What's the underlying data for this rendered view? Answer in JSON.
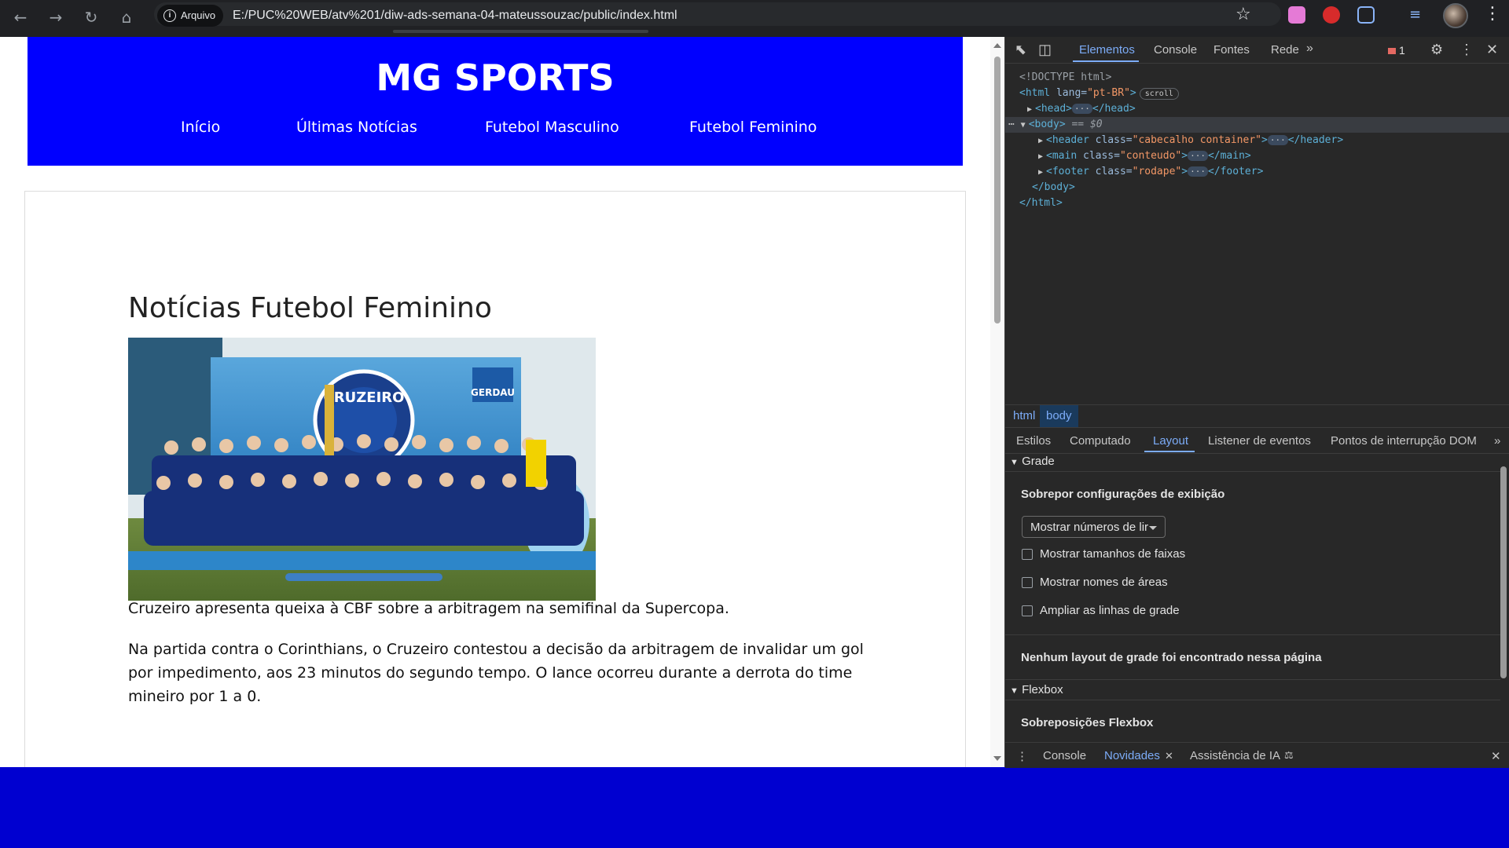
{
  "browser": {
    "security_chip": "Arquivo",
    "url": "E:/PUC%20WEB/atv%201/diw-ads-semana-04-mateussouzac/public/index.html"
  },
  "site": {
    "title": "MG SPORTS",
    "nav": [
      "Início",
      "Últimas Notícias",
      "Futebol Masculino",
      "Futebol Feminino"
    ],
    "section_title": "Notícias Futebol Feminino",
    "photo_text": {
      "club": "CRUZEIRO",
      "sponsor": "GERDAU"
    },
    "caption": "Cruzeiro apresenta queixa à CBF sobre a arbitragem na semifinal da Supercopa.",
    "paragraph": "Na partida contra o Corinthians, o Cruzeiro contestou a decisão da arbitragem de invalidar um gol por impedimento, aos 23 minutos do segundo tempo. O lance ocorreu durante a derrota do time mineiro por 1 a 0."
  },
  "devtools": {
    "tabs": [
      "Elementos",
      "Console",
      "Fontes",
      "Rede"
    ],
    "active_tab": "Elementos",
    "error_count": "1",
    "dom": {
      "doctype": "<!DOCTYPE html>",
      "html_open": "<html",
      "html_lang_attr": "lang",
      "html_lang_val": "\"pt-BR\"",
      "scroll_badge": "scroll",
      "head": "<head>",
      "head_close": "</head>",
      "body": "<body>",
      "body_marker": "== $0",
      "header_open": "<header",
      "header_class_val": "\"cabecalho container\"",
      "header_close": "</header>",
      "main_open": "<main",
      "main_class_val": "\"conteudo\"",
      "main_close": "</main>",
      "footer_open": "<footer",
      "footer_class_val": "\"rodape\"",
      "footer_close": "</footer>",
      "class_attr": "class",
      "body_close": "</body>",
      "html_close": "</html>",
      "ellipsis": "···"
    },
    "breadcrumbs": [
      "html",
      "body"
    ],
    "panel_tabs": [
      "Estilos",
      "Computado",
      "Layout",
      "Listener de eventos",
      "Pontos de interrupção DOM"
    ],
    "active_panel_tab": "Layout",
    "grade": {
      "heading": "Grade",
      "overlay_title": "Sobrepor configurações de exibição",
      "select_value": "Mostrar números de lir",
      "checks": [
        "Mostrar tamanhos de faixas",
        "Mostrar nomes de áreas",
        "Ampliar as linhas de grade"
      ],
      "empty_message": "Nenhum layout de grade foi encontrado nessa página"
    },
    "flexbox": {
      "heading": "Flexbox",
      "overlays_title": "Sobreposições Flexbox"
    },
    "drawer_tabs": [
      "Console",
      "Novidades",
      "Assistência de IA"
    ],
    "active_drawer_tab": "Novidades"
  },
  "colors": {
    "site_header": "#0000ff",
    "desktop_bg": "#0000d0",
    "devtools_accent": "#7cacf8"
  }
}
